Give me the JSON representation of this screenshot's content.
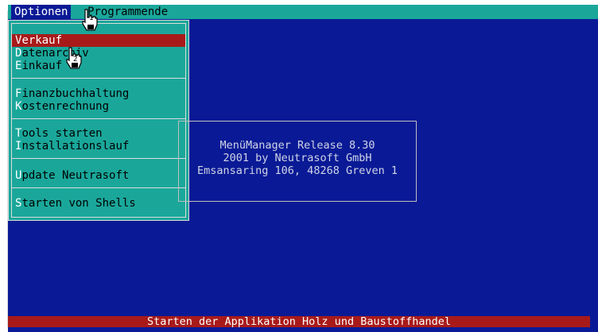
{
  "menubar": {
    "optionen": "Optionen",
    "programmende": "Programmende"
  },
  "dropdown": {
    "items": [
      {
        "hotkey": "V",
        "rest": "erkauf"
      },
      {
        "hotkey": "D",
        "rest": "atenarchiv"
      },
      {
        "hotkey": "E",
        "rest": "inkauf"
      },
      {
        "hotkey": "F",
        "rest": "inanzbuchhaltung"
      },
      {
        "hotkey": "K",
        "rest": "ostenrechnung"
      },
      {
        "hotkey": "T",
        "rest": "ools starten"
      },
      {
        "hotkey": "I",
        "rest": "nstallationslauf"
      },
      {
        "hotkey": "U",
        "rest": "pdate Neutrasoft"
      },
      {
        "hotkey": "S",
        "rest": "tarten von Shells"
      }
    ],
    "selected_index": 0
  },
  "about": {
    "line1": "MenüManager Release  8.30",
    "line2": "2001 by Neutrasoft GmbH",
    "line3": "Emsansaring 106, 48268 Greven 1"
  },
  "statusbar": {
    "text": "Starten der Applikation Holz und Baustoffhandel"
  },
  "cursors": [
    {
      "label": "1",
      "icon": "hand-pointer-icon"
    },
    {
      "label": "2",
      "icon": "hand-pointer-icon"
    }
  ],
  "colors": {
    "background": "#0a1a96",
    "menu": "#1aa79a",
    "highlight": "#a81a1a",
    "text_light": "#cfd4e6"
  }
}
